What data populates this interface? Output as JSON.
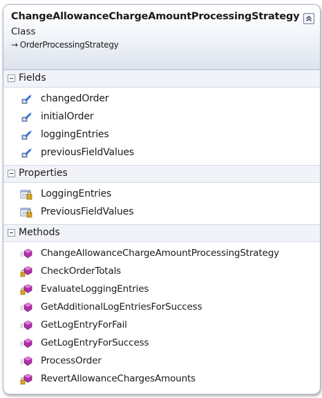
{
  "class": {
    "name": "ChangeAllowanceChargeAmountProcessingStrategy",
    "stereotype": "Class",
    "base_arrow": "→",
    "base": "OrderProcessingStrategy"
  },
  "sections": {
    "fields": {
      "label": "Fields",
      "items": [
        "changedOrder",
        "initialOrder",
        "loggingEntries",
        "previousFieldValues"
      ]
    },
    "properties": {
      "label": "Properties",
      "items": [
        "LoggingEntries",
        "PreviousFieldValues"
      ]
    },
    "methods": {
      "label": "Methods",
      "items": [
        {
          "name": "ChangeAllowanceChargeAmountProcessingStrategy",
          "icon": "public-method-icon"
        },
        {
          "name": "CheckOrderTotals",
          "icon": "private-method-icon"
        },
        {
          "name": "EvaluateLoggingEntries",
          "icon": "private-method-icon"
        },
        {
          "name": "GetAdditionalLogEntriesForSuccess",
          "icon": "public-method-icon"
        },
        {
          "name": "GetLogEntryForFail",
          "icon": "public-method-icon"
        },
        {
          "name": "GetLogEntryForSuccess",
          "icon": "public-method-icon"
        },
        {
          "name": "ProcessOrder",
          "icon": "public-method-icon"
        },
        {
          "name": "RevertAllowanceChargesAmounts",
          "icon": "private-method-icon"
        }
      ]
    }
  },
  "colors": {
    "field_icon": "#2e6fd0",
    "method_icon": "#b02fa8",
    "lock": "#d9a520",
    "header_border": "#a8b4c8"
  }
}
